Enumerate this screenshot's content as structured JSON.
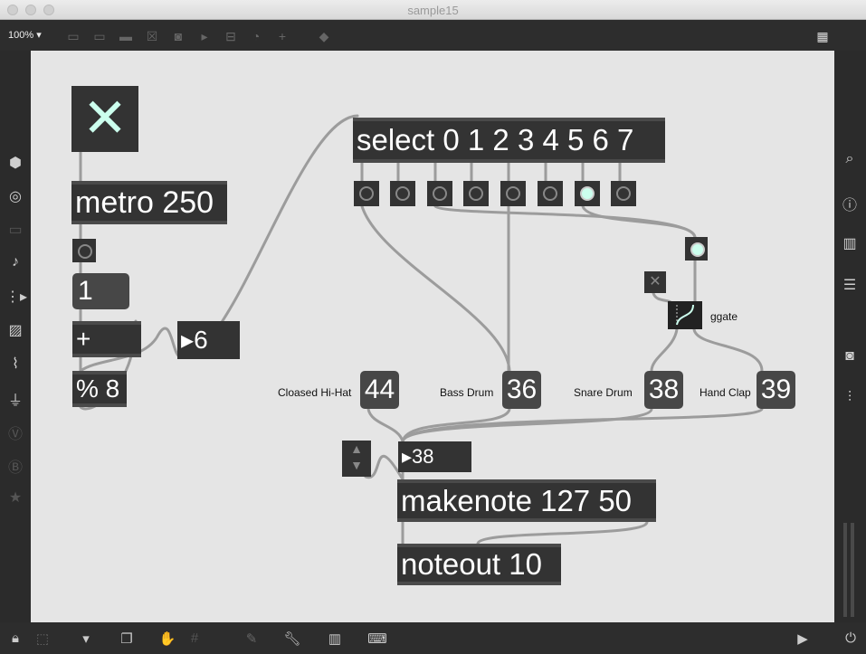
{
  "window": {
    "title": "sample15"
  },
  "toolbar": {
    "zoom": "100%"
  },
  "patch": {
    "metro": "metro 250",
    "msg_one": "1",
    "plus": "+",
    "mod": "% 8",
    "counter_number": "6",
    "select": "select 0 1 2 3 4 5 6 7",
    "active_bang_index": 6,
    "ggate_label": "ggate",
    "drums": [
      {
        "label": "Cloased  Hi-Hat",
        "value": "44"
      },
      {
        "label": "Bass Drum",
        "value": "36"
      },
      {
        "label": "Snare Drum",
        "value": "38"
      },
      {
        "label": "Hand Clap",
        "value": "39"
      }
    ],
    "note_number": "38",
    "makenote": "makenote 127 50",
    "noteout": "noteout 10"
  },
  "colors": {
    "canvas": "#e5e5e5",
    "object": "#333333",
    "cable": "#9a9a9a"
  }
}
